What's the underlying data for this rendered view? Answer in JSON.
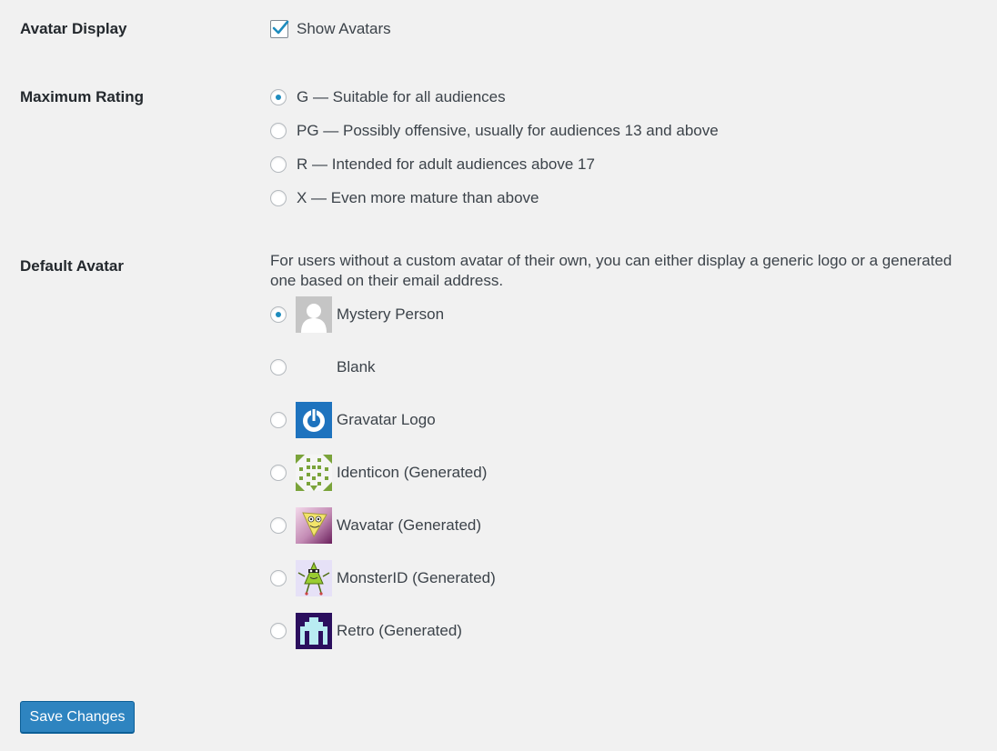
{
  "avatar_display": {
    "label": "Avatar Display",
    "checkbox_label": "Show Avatars",
    "checked": true
  },
  "maximum_rating": {
    "label": "Maximum Rating",
    "options": [
      {
        "label": "G — Suitable for all audiences",
        "checked": true
      },
      {
        "label": "PG — Possibly offensive, usually for audiences 13 and above",
        "checked": false
      },
      {
        "label": "R — Intended for adult audiences above 17",
        "checked": false
      },
      {
        "label": "X — Even more mature than above",
        "checked": false
      }
    ]
  },
  "default_avatar": {
    "label": "Default Avatar",
    "description": "For users without a custom avatar of their own, you can either display a generic logo or a generated one based on their email address.",
    "options": [
      {
        "label": "Mystery Person",
        "checked": true,
        "icon": "mystery-person-icon"
      },
      {
        "label": "Blank",
        "checked": false,
        "icon": "blank-icon"
      },
      {
        "label": "Gravatar Logo",
        "checked": false,
        "icon": "gravatar-logo-icon"
      },
      {
        "label": "Identicon (Generated)",
        "checked": false,
        "icon": "identicon-icon"
      },
      {
        "label": "Wavatar (Generated)",
        "checked": false,
        "icon": "wavatar-icon"
      },
      {
        "label": "MonsterID (Generated)",
        "checked": false,
        "icon": "monsterid-icon"
      },
      {
        "label": "Retro (Generated)",
        "checked": false,
        "icon": "retro-icon"
      }
    ]
  },
  "save_button": {
    "label": "Save Changes"
  },
  "colors": {
    "background": "#f1f1f1",
    "accent": "#1e8cbe",
    "button": "#2e84c0"
  }
}
